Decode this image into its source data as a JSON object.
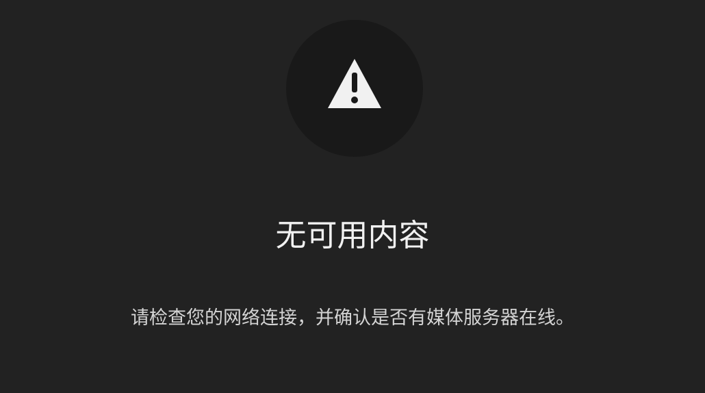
{
  "empty_state": {
    "icon": "warning-icon",
    "title": "无可用内容",
    "message": "请检查您的网络连接，并确认是否有媒体服务器在线。"
  },
  "colors": {
    "background": "#222222",
    "icon_circle": "#191919",
    "icon": "#f1f1f1",
    "title": "#f1f1f1",
    "message": "#d4d4d4"
  }
}
